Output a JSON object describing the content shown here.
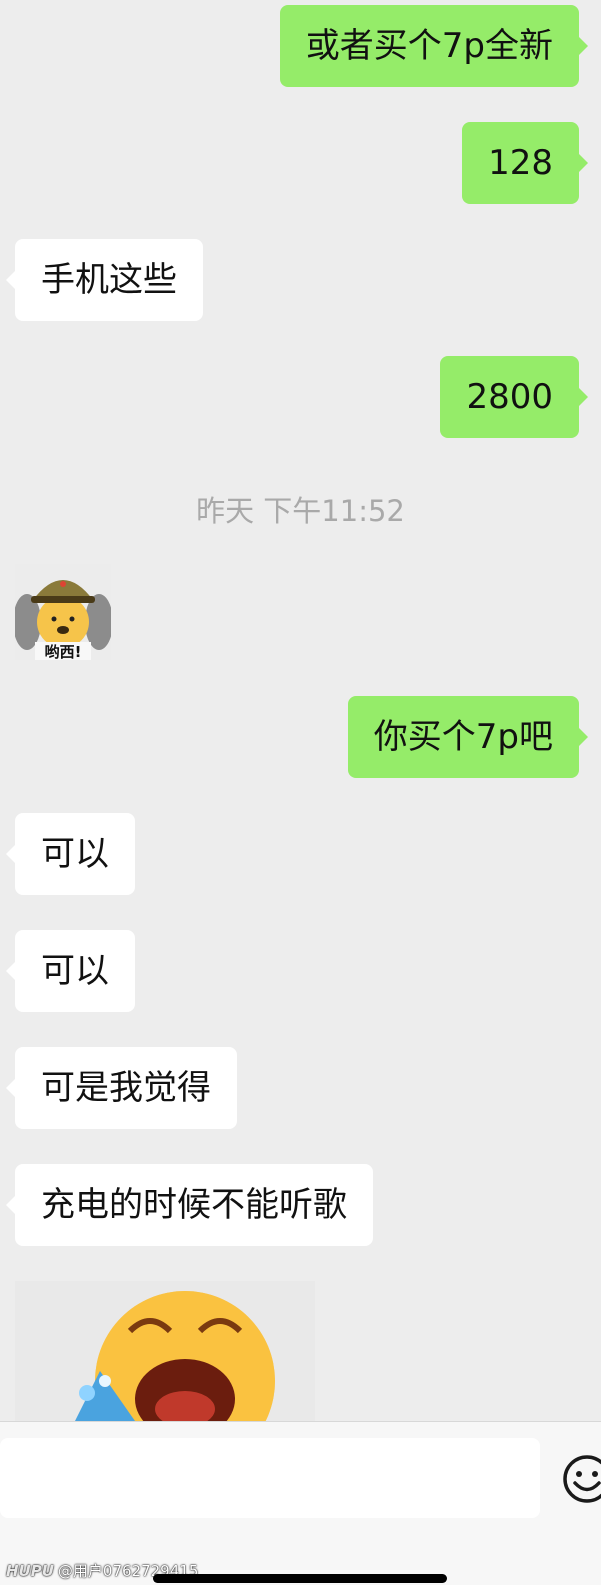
{
  "messages": [
    {
      "text": "或者买个7p全新",
      "side": "out"
    },
    {
      "text": "128",
      "side": "out"
    },
    {
      "text": "手机这些",
      "side": "in"
    },
    {
      "text": "2800",
      "side": "out"
    },
    {
      "text": "你买个7p吧",
      "side": "out"
    },
    {
      "text": "可以",
      "side": "in"
    },
    {
      "text": "可以",
      "side": "in"
    },
    {
      "text": "可是我觉得",
      "side": "in"
    },
    {
      "text": "充电的时候不能听歌",
      "side": "in"
    }
  ],
  "timestamp": "昨天 下午11:52",
  "stickers": {
    "small_caption": "哟西!",
    "small_name": "soldier-bear-sticker",
    "big_name": "crying-emoji-sticker"
  },
  "input_bar": {
    "emoji_icon": "smiley-icon"
  },
  "watermark": {
    "brand": "HUPU",
    "user": "@用户0762729415"
  },
  "colors": {
    "background": "#ededed",
    "outgoing_bubble": "#95ec69",
    "incoming_bubble": "#ffffff"
  }
}
